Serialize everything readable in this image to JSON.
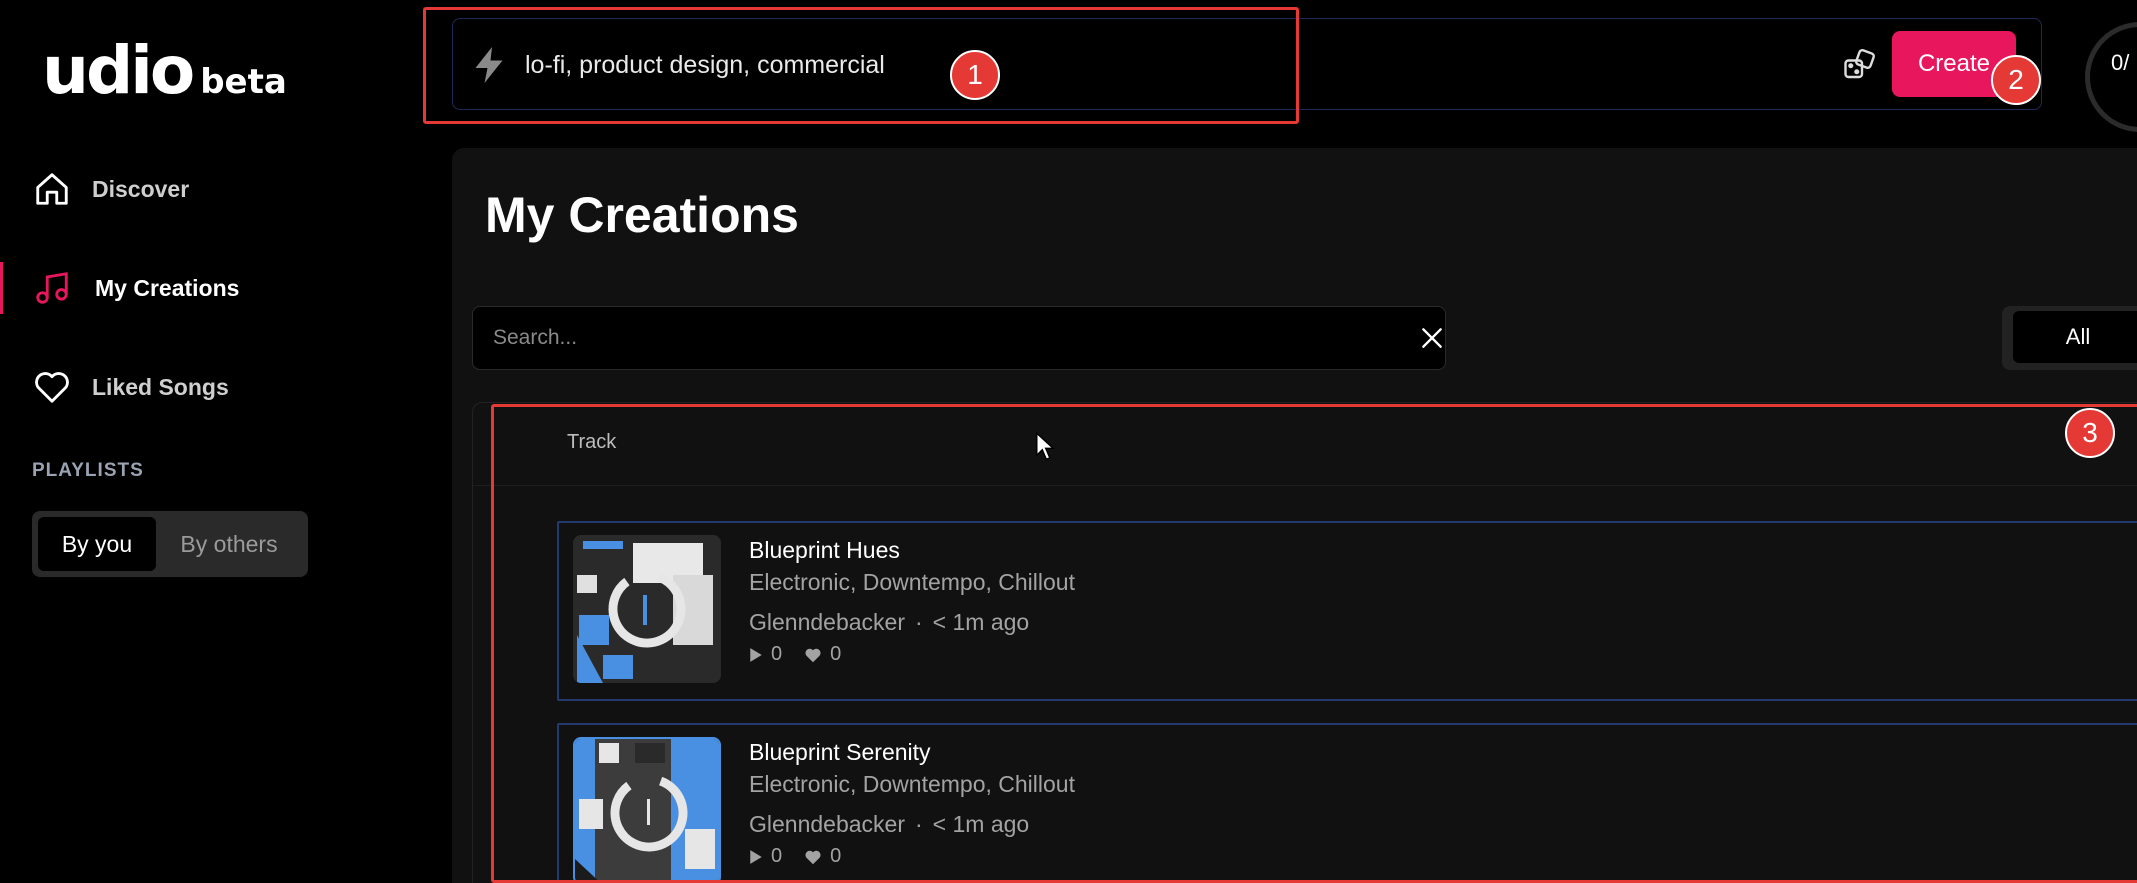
{
  "brand": {
    "name": "udio",
    "tag": "beta"
  },
  "sidebar": {
    "items": [
      {
        "label": "Discover",
        "icon": "home-icon"
      },
      {
        "label": "My Creations",
        "icon": "music-note-icon",
        "active": true,
        "accent": "#e8175d"
      },
      {
        "label": "Liked Songs",
        "icon": "heart-icon"
      }
    ],
    "playlists_heading": "PLAYLISTS",
    "playlist_tabs": {
      "by_you": "By you",
      "by_others": "By others"
    }
  },
  "prompt": {
    "text": "lo-fi, product design, commercial",
    "icon": "bolt-icon",
    "dice_icon": "dice-icon",
    "create_label": "Create",
    "create_color": "#e8175d"
  },
  "credits": {
    "text": "0/"
  },
  "main": {
    "title": "My Creations",
    "search": {
      "placeholder": "Search..."
    },
    "filter": {
      "selected": "All"
    },
    "table": {
      "column_header": "Track",
      "tracks": [
        {
          "title": "Blueprint Hues",
          "tags": "Electronic, Downtempo, Chillout",
          "artist": "Glenndebacker",
          "separator": "·",
          "time": "< 1m ago",
          "plays": "0",
          "likes": "0"
        },
        {
          "title": "Blueprint Serenity",
          "tags": "Electronic, Downtempo, Chillout",
          "artist": "Glenndebacker",
          "separator": "·",
          "time": "< 1m ago",
          "plays": "0",
          "likes": "0"
        }
      ]
    }
  },
  "annotations": [
    {
      "number": "1"
    },
    {
      "number": "2"
    },
    {
      "number": "3"
    }
  ]
}
